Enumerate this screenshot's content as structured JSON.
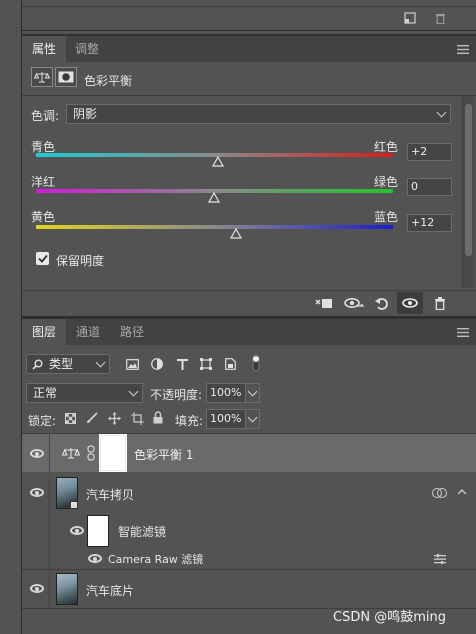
{
  "top_toolbar": {
    "new_icon": "new-layer-icon",
    "trash_icon": "trash-icon"
  },
  "properties_panel": {
    "tabs": [
      {
        "label": "属性"
      },
      {
        "label": "调整"
      }
    ],
    "menu_icon": "panel-menu-icon",
    "header": {
      "title": "色彩平衡",
      "icons": [
        "balance-scale-icon",
        "mask-icon"
      ]
    },
    "tone": {
      "label": "色调:",
      "value": "阴影"
    },
    "sliders": [
      {
        "left": "青色",
        "right": "红色",
        "value": "+2",
        "position": 0.51
      },
      {
        "left": "洋红",
        "right": "绿色",
        "value": "0",
        "position": 0.5
      },
      {
        "left": "黄色",
        "right": "蓝色",
        "value": "+12",
        "position": 0.56
      }
    ],
    "preserve_luminosity": {
      "label": "保留明度",
      "checked": true
    },
    "footer_icons": [
      "clip-to-layer-icon",
      "view-previous-icon",
      "reset-icon",
      "visibility-icon",
      "trash-icon"
    ]
  },
  "layers_panel": {
    "tabs": [
      {
        "label": "图层"
      },
      {
        "label": "通道"
      },
      {
        "label": "路径"
      }
    ],
    "filter": {
      "label": "类型",
      "icons": [
        "image-filter-icon",
        "adjustment-filter-icon",
        "type-filter-icon",
        "shape-filter-icon",
        "smart-object-filter-icon",
        "filter-toggle-icon"
      ]
    },
    "blend_mode": {
      "value": "正常"
    },
    "opacity": {
      "label": "不透明度:",
      "value": "100%"
    },
    "lock": {
      "label": "锁定:",
      "icons": [
        "lock-transparent-icon",
        "lock-brush-icon",
        "lock-move-icon",
        "lock-artboard-icon",
        "lock-all-icon"
      ]
    },
    "fill": {
      "label": "填充:",
      "value": "100%"
    },
    "layers": [
      {
        "name": "色彩平衡 1",
        "type": "adjustment",
        "selected": true
      },
      {
        "name": "汽车拷贝",
        "type": "smart-object"
      },
      {
        "name": "智能滤镜",
        "type": "smart-filter-mask"
      },
      {
        "name": "Camera Raw 滤镜",
        "type": "filter"
      },
      {
        "name": "汽车底片",
        "type": "image"
      }
    ]
  },
  "watermark": {
    "text": "CSDN @鸣鼓ming"
  }
}
